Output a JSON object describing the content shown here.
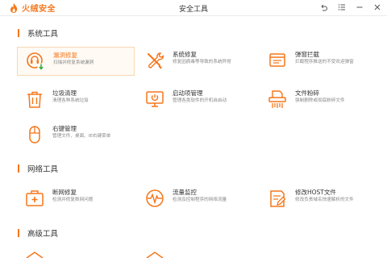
{
  "app": {
    "brand": "火绒安全",
    "window_title": "安全工具"
  },
  "colors": {
    "accent": "#f5761a",
    "active_border": "#f7d7b5",
    "active_bg": "#fffaf4"
  },
  "window_controls": [
    {
      "icon": "restore-icon"
    },
    {
      "icon": "menu-icon"
    },
    {
      "icon": "minimize-icon"
    },
    {
      "icon": "close-icon"
    }
  ],
  "sections": [
    {
      "title": "系统工具",
      "tools": [
        {
          "name": "漏洞修复",
          "desc": "扫描并修复系统漏洞",
          "icon": "vulnerability-fix-icon",
          "active": true
        },
        {
          "name": "系统修复",
          "desc": "修复因病毒等导致的系统异常",
          "icon": "system-repair-icon"
        },
        {
          "name": "弹窗拦截",
          "desc": "拦截程序推送的不受欢迎弹窗",
          "icon": "popup-block-icon"
        },
        {
          "name": "垃圾清理",
          "desc": "清理各种系统垃圾",
          "icon": "trash-icon"
        },
        {
          "name": "启动项管理",
          "desc": "管理各类软件的开机自启动",
          "icon": "startup-icon"
        },
        {
          "name": "文件粉碎",
          "desc": "强制删除或彻底粉碎文件",
          "icon": "file-shred-icon"
        },
        {
          "name": "右键管理",
          "desc": "管理文件、桌面、IE右键菜单",
          "icon": "mouse-icon"
        }
      ]
    },
    {
      "title": "网络工具",
      "tools": [
        {
          "name": "断网修复",
          "desc": "检测并修复断网问题",
          "icon": "network-fix-icon"
        },
        {
          "name": "流量监控",
          "desc": "检测及控制程序的网络流量",
          "icon": "traffic-monitor-icon"
        },
        {
          "name": "修改HOST文件",
          "desc": "修改负责域名快速解析的文件",
          "icon": "host-file-icon"
        }
      ]
    },
    {
      "title": "高级工具",
      "tools": []
    }
  ]
}
